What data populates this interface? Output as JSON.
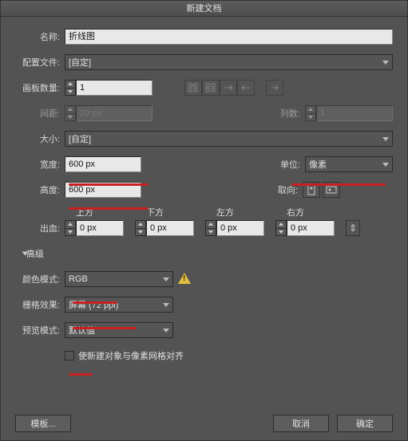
{
  "title": "新建文档",
  "labels": {
    "name": "名称:",
    "profile": "配置文件:",
    "artboards": "画板数量:",
    "spacing": "间距:",
    "columns": "列数:",
    "size": "大小:",
    "width": "宽度:",
    "units": "单位:",
    "height": "高度:",
    "orientation": "取向:",
    "bleed": "出血:",
    "top": "上方",
    "bottom": "下方",
    "left": "左方",
    "right": "右方",
    "advanced": "高级",
    "colorMode": "颜色模式:",
    "raster": "栅格效果:",
    "preview": "预览模式:",
    "alignGrid": "使新建对象与像素网格对齐"
  },
  "values": {
    "name": "折线图",
    "profile": "[自定]",
    "artboards": "1",
    "spacing": "20 px",
    "columns": "1",
    "size": "[自定]",
    "width": "600 px",
    "height": "600 px",
    "units": "像素",
    "bleedTop": "0 px",
    "bleedBottom": "0 px",
    "bleedLeft": "0 px",
    "bleedRight": "0 px",
    "colorMode": "RGB",
    "raster": "屏幕 (72 ppi)",
    "preview": "默认值"
  },
  "buttons": {
    "templates": "模板...",
    "cancel": "取消",
    "ok": "确定"
  }
}
